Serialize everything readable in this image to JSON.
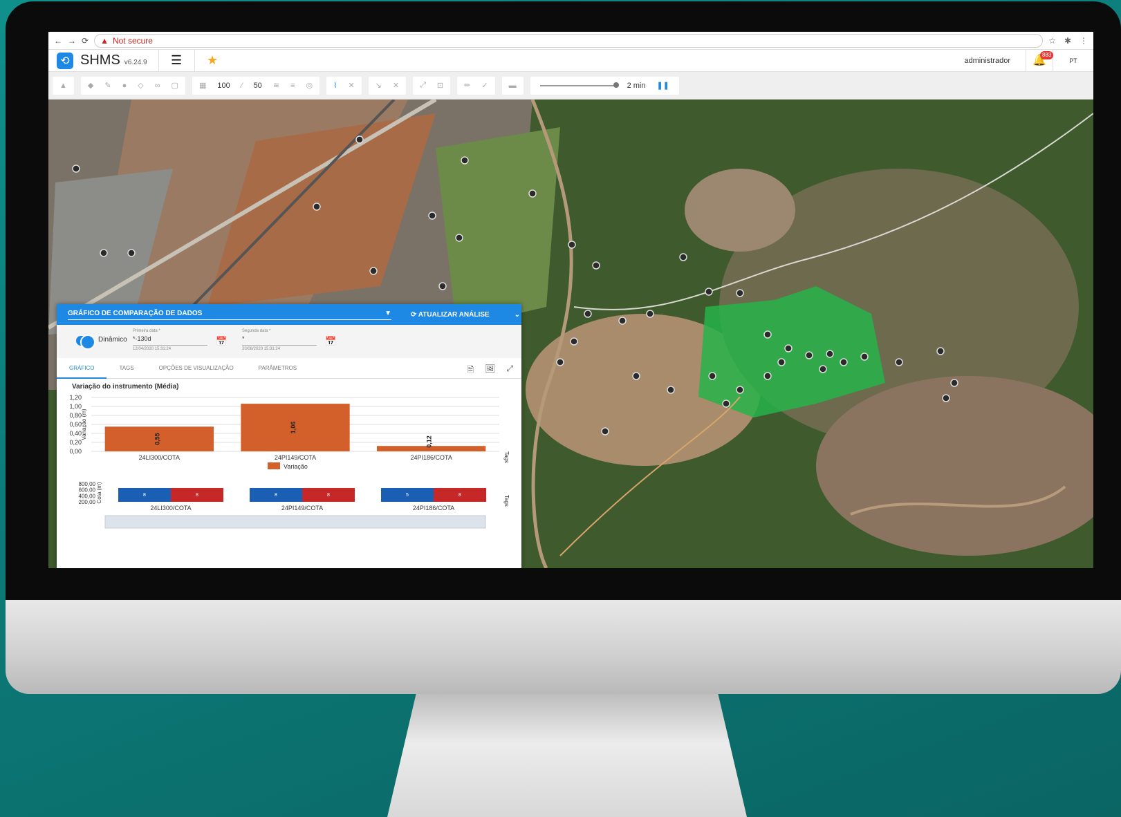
{
  "browser": {
    "security": "Not secure"
  },
  "app": {
    "name": "SHMS",
    "version": "v6.24.9",
    "user": "administrador",
    "notifications": "883",
    "lang": "PT"
  },
  "toolbar": {
    "grid_value": "100",
    "scale_value": "50",
    "refresh": "2 min"
  },
  "panel": {
    "title": "GRÁFICO DE COMPARAÇÃO DE DADOS",
    "refresh_label": "ATUALIZAR ANÁLISE",
    "dynamic_label": "Dinâmico",
    "first_date": {
      "label": "Primeira data *",
      "value": "*-130d",
      "hint": "12/04/2020 15:31:24"
    },
    "second_date": {
      "label": "Segunda data *",
      "value": "*",
      "hint": "20/08/2020 15:31:24"
    },
    "tabs": [
      "GRÁFICO",
      "TAGS",
      "OPÇÕES DE VISUALIZAÇÃO",
      "PARÂMETROS"
    ],
    "chart_title": "Variação do instrumento (Média)"
  },
  "chart_data": [
    {
      "type": "bar",
      "categories": [
        "24LI300/COTA",
        "24PI149/COTA",
        "24PI186/COTA"
      ],
      "values": [
        0.55,
        1.06,
        0.12
      ],
      "value_labels": [
        "0,55",
        "1,06",
        "0,12"
      ],
      "ylabel": "Variação (m)",
      "xlabel": "Tags",
      "ylim": [
        0,
        1.2
      ],
      "yticks": [
        "1,20",
        "1,00",
        "0,80",
        "0,60",
        "0,40",
        "0,20",
        "0,00"
      ],
      "legend": "Variação",
      "color": "#d35f2a"
    },
    {
      "type": "bar",
      "categories": [
        "24LI300/COTA",
        "24PI149/COTA",
        "24PI186/COTA"
      ],
      "ylabel": "Cota (m)",
      "xlabel": "Tags",
      "yticks": [
        "800,00",
        "600,00",
        "400,00",
        "200,00"
      ],
      "colors": [
        "#1a5fb4",
        "#c62828"
      ],
      "labels_blue": [
        "8",
        "8",
        "5"
      ],
      "labels_red": [
        "8",
        "8",
        "8"
      ]
    }
  ],
  "colors": {
    "accent": "#1e88e5",
    "bar": "#d35f2a"
  }
}
